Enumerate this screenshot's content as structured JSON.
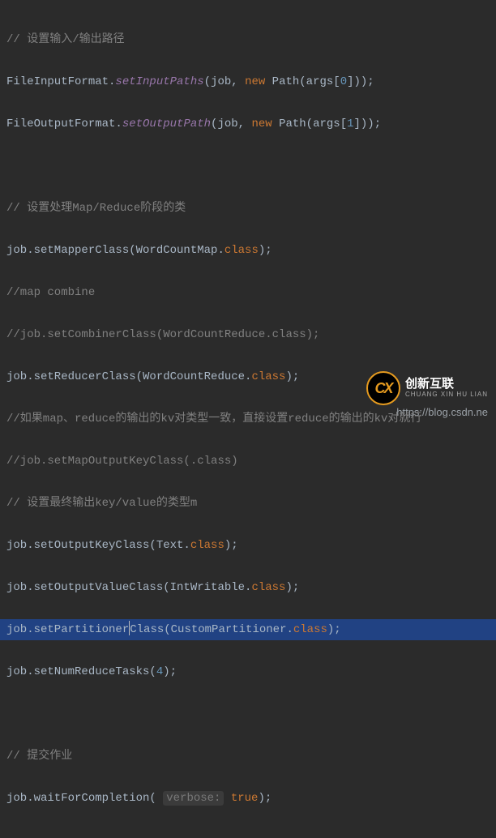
{
  "code": {
    "l1": "// 设置输入/输出路径",
    "l2a": "FileInputFormat.",
    "l2b": "setInputPaths",
    "l2c": "(job, ",
    "l2d": "new ",
    "l2e": "Path(args[",
    "l2f": "0",
    "l2g": "]));",
    "l3a": "FileOutputFormat.",
    "l3b": "setOutputPath",
    "l3c": "(job, ",
    "l3d": "new ",
    "l3e": "Path(args[",
    "l3f": "1",
    "l3g": "]));",
    "l5": "// 设置处理Map/Reduce阶段的类",
    "l6a": "job.setMapperClass(WordCountMap.",
    "l6b": "class",
    "l6c": ");",
    "l7": "//map combine",
    "l8": "//job.setCombinerClass(WordCountReduce.class);",
    "l9a": "job.setReducerClass(WordCountReduce.",
    "l9b": "class",
    "l9c": ");",
    "l10": "//如果map、reduce的输出的kv对类型一致，直接设置reduce的输出的kv对就行",
    "l11": "//job.setMapOutputKeyClass(.class)",
    "l12": "// 设置最终输出key/value的类型m",
    "l13a": "job.setOutputKeyClass(Text.",
    "l13b": "class",
    "l13c": ");",
    "l14a": "job.setOutputValueClass(IntWritable.",
    "l14b": "class",
    "l14c": ");",
    "l15a": "job.setPartitioner",
    "l15b": "Class(CustomPartitioner.",
    "l15c": "class",
    "l15d": ");",
    "l16a": "job.setNumReduceTasks(",
    "l16b": "4",
    "l16c": ");",
    "l18": "// 提交作业",
    "l19a": "job.waitForCompletion( ",
    "l19hint": "verbose:",
    "l19b": " true",
    "l19c": ");"
  },
  "branding": {
    "logo_letters": "CX",
    "logo_main": "创新互联",
    "logo_sub": "CHUANG XIN HU LIAN",
    "watermark": "https://blog.csdn.ne"
  }
}
